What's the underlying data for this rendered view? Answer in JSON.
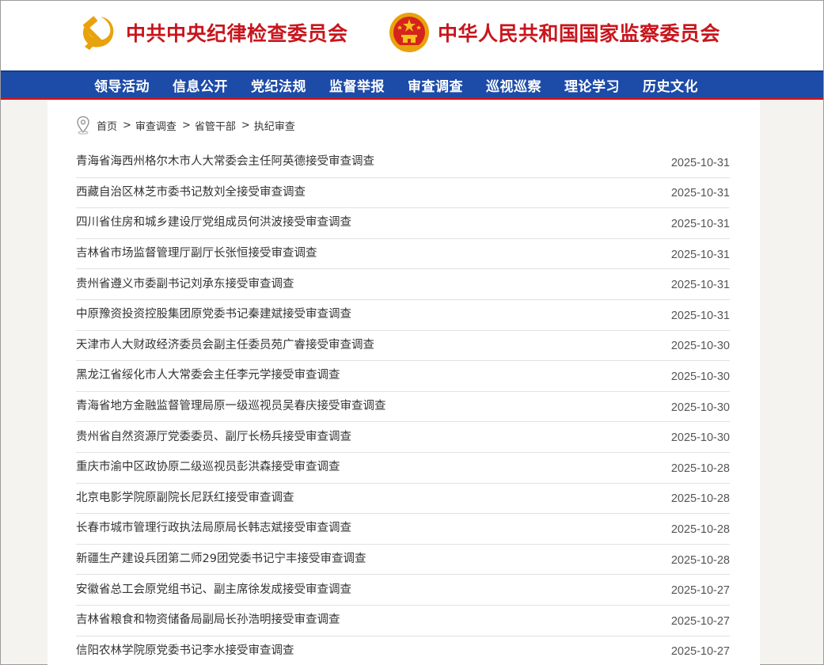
{
  "header": {
    "left_org": "中共中央纪律检查委员会",
    "right_org": "中华人民共和国国家监察委员会",
    "left_emblem_icon": "party-emblem-icon",
    "right_emblem_icon": "national-emblem-icon",
    "brand_red": "#c8161d",
    "nav_blue": "#1d4ca8"
  },
  "nav": {
    "items": [
      "领导活动",
      "信息公开",
      "党纪法规",
      "监督举报",
      "审查调查",
      "巡视巡察",
      "理论学习",
      "历史文化"
    ]
  },
  "breadcrumb": {
    "icon": "location-pin-icon",
    "items": [
      "首页",
      "审查调查",
      "省管干部",
      "执纪审查"
    ],
    "separator": ">"
  },
  "articles": [
    {
      "title": "青海省海西州格尔木市人大常委会主任阿英德接受审查调查",
      "date": "2025-10-31"
    },
    {
      "title": "西藏自治区林芝市委书记敖刘全接受审查调查",
      "date": "2025-10-31"
    },
    {
      "title": "四川省住房和城乡建设厅党组成员何洪波接受审查调查",
      "date": "2025-10-31"
    },
    {
      "title": "吉林省市场监督管理厅副厅长张恒接受审查调查",
      "date": "2025-10-31"
    },
    {
      "title": "贵州省遵义市委副书记刘承东接受审查调查",
      "date": "2025-10-31"
    },
    {
      "title": "中原豫资投资控股集团原党委书记秦建斌接受审查调查",
      "date": "2025-10-31"
    },
    {
      "title": "天津市人大财政经济委员会副主任委员苑广睿接受审查调查",
      "date": "2025-10-30"
    },
    {
      "title": "黑龙江省绥化市人大常委会主任李元学接受审查调查",
      "date": "2025-10-30"
    },
    {
      "title": "青海省地方金融监督管理局原一级巡视员吴春庆接受审查调查",
      "date": "2025-10-30"
    },
    {
      "title": "贵州省自然资源厅党委委员、副厅长杨兵接受审查调查",
      "date": "2025-10-30"
    },
    {
      "title": "重庆市渝中区政协原二级巡视员彭洪森接受审查调查",
      "date": "2025-10-28"
    },
    {
      "title": "北京电影学院原副院长尼跃红接受审查调查",
      "date": "2025-10-28"
    },
    {
      "title": "长春市城市管理行政执法局原局长韩志斌接受审查调查",
      "date": "2025-10-28"
    },
    {
      "title": "新疆生产建设兵团第二师29团党委书记宁丰接受审查调查",
      "date": "2025-10-28"
    },
    {
      "title": "安徽省总工会原党组书记、副主席徐发成接受审查调查",
      "date": "2025-10-27"
    },
    {
      "title": "吉林省粮食和物资储备局副局长孙浩明接受审查调查",
      "date": "2025-10-27"
    },
    {
      "title": "信阳农林学院原党委书记李水接受审查调查",
      "date": "2025-10-27"
    }
  ]
}
